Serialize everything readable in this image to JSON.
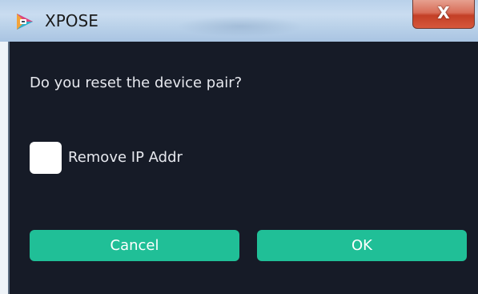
{
  "window": {
    "title": "XPOSE",
    "close_glyph": "X",
    "icon": "xpose-app-icon"
  },
  "dialog": {
    "message": "Do you reset the device pair?",
    "checkbox": {
      "label": "Remove IP Addr",
      "checked": false
    },
    "buttons": {
      "cancel_label": "Cancel",
      "ok_label": "OK"
    }
  },
  "colors": {
    "background": "#161b27",
    "button": "#20bf97",
    "text": "#e6e8ee",
    "close_button": "#c33f26"
  }
}
